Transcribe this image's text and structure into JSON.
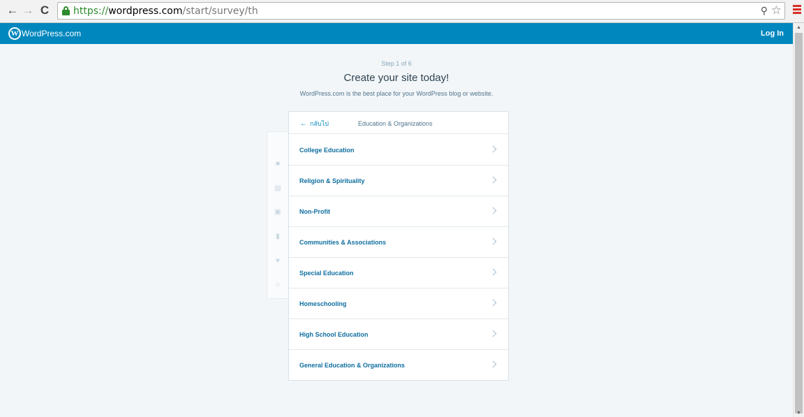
{
  "browser": {
    "url_scheme": "https://",
    "url_host": "wordpress.com",
    "url_path": "/start/survey/th"
  },
  "masterbar": {
    "brand": "WordPress.com",
    "login": "Log In",
    "color": "#0087be"
  },
  "header": {
    "step": "Step 1 of 6",
    "title": "Create your site today!",
    "subtitle": "WordPress.com is the best place for your WordPress blog or website."
  },
  "card": {
    "back_label": "กลับไป",
    "category_title": "Education & Organizations",
    "items": [
      {
        "label": "College Education"
      },
      {
        "label": "Religion & Spirituality"
      },
      {
        "label": "Non-Profit"
      },
      {
        "label": "Communities & Associations"
      },
      {
        "label": "Special Education"
      },
      {
        "label": "Homeschooling"
      },
      {
        "label": "High School Education"
      },
      {
        "label": "General Education & Organizations"
      }
    ]
  },
  "background_card_icons": [
    "video-icon",
    "building-icon",
    "briefcase-icon",
    "book-icon",
    "heart-icon",
    "home-icon"
  ]
}
